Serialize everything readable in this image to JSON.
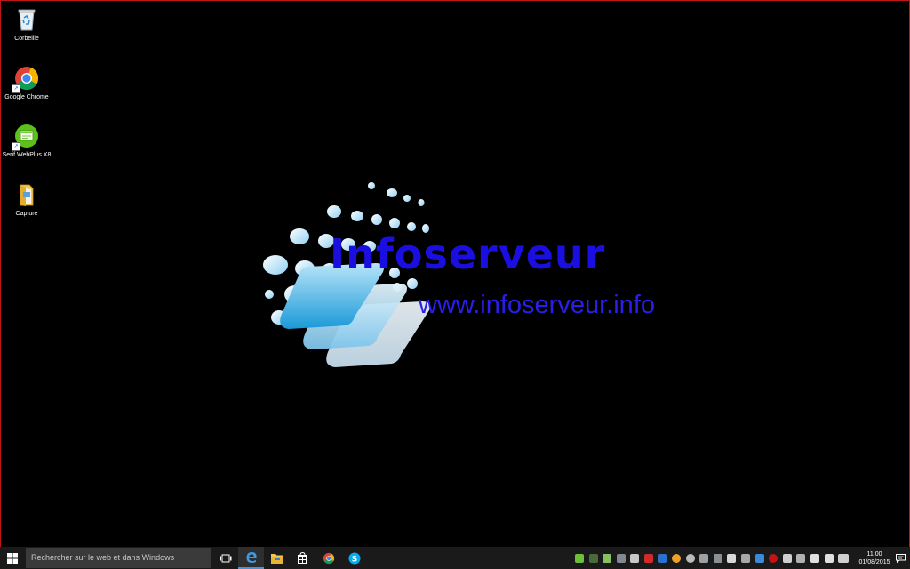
{
  "desktop": {
    "icons": [
      {
        "name": "recycle-bin",
        "label": "Corbeille"
      },
      {
        "name": "google-chrome",
        "label": "Google Chrome"
      },
      {
        "name": "serif-webplus",
        "label": "Serif WebPlus X8"
      },
      {
        "name": "capture-folder",
        "label": "Capture"
      }
    ],
    "wallpaper": {
      "title": "Infoserveur",
      "url": "www.infoserveur.info",
      "title_color": "#1a0fe0",
      "url_color": "#2a1ee8"
    }
  },
  "taskbar": {
    "search_placeholder": "Rechercher sur le web et dans Windows",
    "pinned": [
      "task-view-icon",
      "edge-icon",
      "file-explorer-icon",
      "store-icon",
      "chrome-icon",
      "skype-icon"
    ],
    "active_app": "edge-icon",
    "accent": "#4a90d9",
    "tray_icons": [
      "green-leaf-icon",
      "network-monitor-icon",
      "speech-icon",
      "camera-icon",
      "tablet-icon",
      "pdf-icon",
      "bluetooth-icon",
      "weather-icon",
      "gauge-icon",
      "card-reader-icon",
      "book-icon",
      "document-icon",
      "android-icon",
      "dropbox-icon",
      "adobe-icon",
      "battery-icon",
      "usb-icon",
      "wifi-icon",
      "volume-icon",
      "keyboard-icon"
    ],
    "clock": {
      "time": "11:00",
      "date": "01/08/2015"
    }
  }
}
